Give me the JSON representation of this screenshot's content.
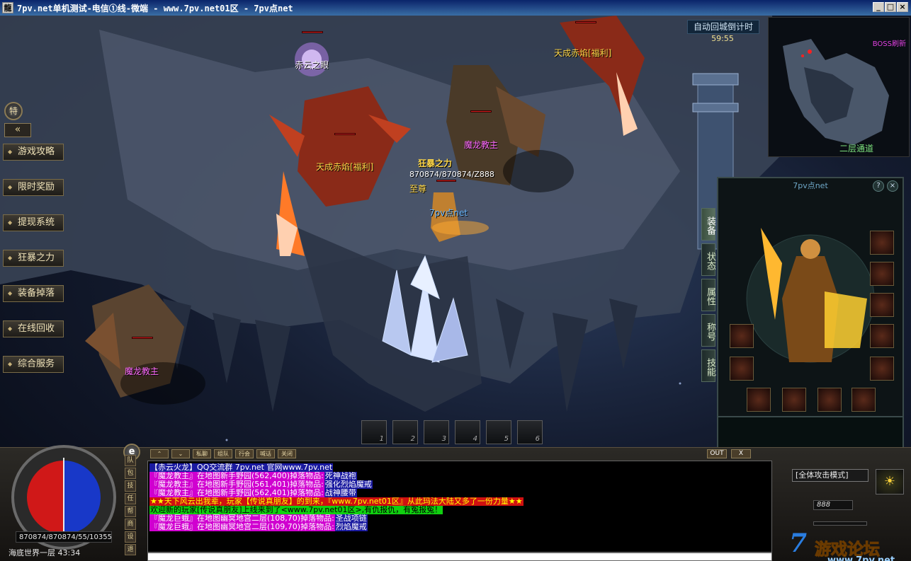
{
  "window": {
    "title": "7pv.net单机测试-电信①线-微端 - www.7pv.net01区 - 7pv点net",
    "icon_label": "龍",
    "minimize": "_",
    "restore": "□",
    "close": "×"
  },
  "timer": {
    "label": "自动回城倒计时",
    "value": "59:55"
  },
  "side_menu": {
    "toggle": "特",
    "collapse": "«",
    "items": [
      "游戏攻略",
      "限时奖励",
      "提现系统",
      "狂暴之力",
      "装备掉落",
      "在线回收",
      "综合服务"
    ]
  },
  "minimap": {
    "boss_label": "BOSS刷新",
    "exit_label": "二层通道"
  },
  "entities": {
    "boss_eye": "赤云之眼",
    "demon_left": "天成赤焰[福利]",
    "demon_top": "天成赤焰[福利]",
    "guardian_center": "魔龙教主",
    "guardian_left": "魔龙教主",
    "player_title": "狂暴之力",
    "player_stats": "870874/870874/Z888",
    "player_rank": "至尊",
    "player_name": "7pv点net"
  },
  "char_panel": {
    "title": "7pv点net",
    "help": "?",
    "close": "×",
    "tabs": [
      "装备",
      "状态",
      "属性",
      "称号",
      "技能"
    ]
  },
  "skillbar": {
    "slots": [
      "1",
      "2",
      "3",
      "4",
      "5",
      "6"
    ]
  },
  "hud": {
    "hpmp": "870874/870874/55/10355",
    "map": "海底世界一层 43:34",
    "e_button": "e",
    "attack_mode": "[全体攻击模式]",
    "level": "888",
    "exp_fraction": 0.0,
    "icons": [
      "队",
      "包",
      "技",
      "任",
      "帮",
      "商",
      "设",
      "退"
    ]
  },
  "chat": {
    "toolbar": [
      "⌃",
      "⌄",
      "私聊",
      "组队",
      "行会",
      "喊话",
      "关闭"
    ],
    "out": "OUT",
    "x": "X",
    "lines": [
      {
        "parts": [
          {
            "text": "【赤云火龙】QQ交流群 7pv.net 官网www.7pv.net",
            "color": "#fff",
            "bg": "#1a1aa0"
          }
        ]
      },
      {
        "parts": [
          {
            "text": "『魔龙教主』在地图新手野园(562,400)掉落物品:",
            "color": "#fff",
            "bg": "#d000d0"
          },
          {
            "text": "死神战袍",
            "color": "#fff",
            "bg": "#1a1aa0"
          }
        ]
      },
      {
        "parts": [
          {
            "text": "『魔龙教主』在地图新手野园(561,401)掉落物品:",
            "color": "#fff",
            "bg": "#d000d0"
          },
          {
            "text": "强化烈焰魔戒",
            "color": "#fff",
            "bg": "#1a1aa0"
          }
        ]
      },
      {
        "parts": [
          {
            "text": "『魔龙教主』在地图新手野园(562,401)掉落物品:",
            "color": "#fff",
            "bg": "#d000d0"
          },
          {
            "text": "战神腰带",
            "color": "#fff",
            "bg": "#1a1aa0"
          }
        ]
      },
      {
        "parts": [
          {
            "text": "★★天下风云出我辈，玩家【传说真朋友】的到来，『www.7pv.net01区』从此玛法大陆又多了一份力量★★",
            "color": "#ffff00",
            "bg": "#d01010"
          }
        ]
      },
      {
        "parts": [
          {
            "text": "欢迎新的玩家[传说真朋友]上线来到了<www.7pv.net01区>,有仇报仇，有冤报冤！",
            "color": "#000",
            "bg": "#10d010"
          }
        ]
      },
      {
        "parts": [
          {
            "text": "『魔龙巨蛾』在地图幽冥地宫二层(108,70)掉落物品:",
            "color": "#fff",
            "bg": "#d000d0"
          },
          {
            "text": "圣战项链",
            "color": "#fff",
            "bg": "#1a1aa0"
          }
        ]
      },
      {
        "parts": [
          {
            "text": "『魔龙巨蛾』在地图幽冥地宫二层(109,70)掉落物品:",
            "color": "#fff",
            "bg": "#d000d0"
          },
          {
            "text": "烈焰魔戒",
            "color": "#fff",
            "bg": "#1a1aa0"
          }
        ]
      }
    ]
  },
  "watermark": {
    "big": "7",
    "cn": "游戏论坛",
    "url": "www.7pv.net"
  },
  "colors": {
    "title_gradient_start": "#0a246a",
    "hp_orb": "#d01818",
    "mp_orb": "#1838c8",
    "label_gold": "#ffd84a",
    "label_magenta": "#ff6aff"
  }
}
